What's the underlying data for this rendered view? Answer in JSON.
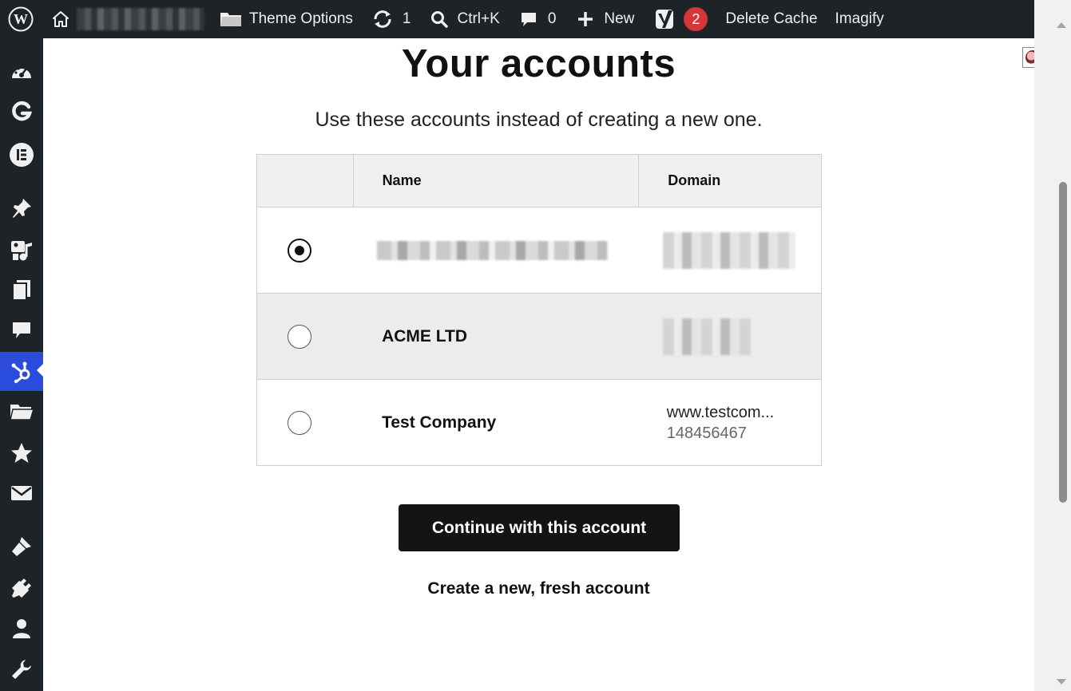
{
  "adminbar": {
    "theme_options": "Theme Options",
    "updates_count": "1",
    "search_shortcut": "Ctrl+K",
    "comments_count": "0",
    "new_label": "New",
    "yoast_badge": "2",
    "delete_cache": "Delete Cache",
    "imagify": "Imagify"
  },
  "sidebar": {
    "items": [
      "dashboard-icon",
      "g-icon",
      "elementor-icon",
      "pin-icon",
      "media-icon",
      "pages-icon",
      "comments-icon",
      "hubspot-icon",
      "folder-icon",
      "star-icon",
      "mail-icon",
      "brush-icon",
      "plugin-icon",
      "user-icon",
      "wrench-icon"
    ],
    "active": "hubspot-icon",
    "active_color": "#2b4bdc"
  },
  "main": {
    "title": "Your accounts",
    "subtitle": "Use these accounts instead of creating a new one.",
    "table": {
      "headers": [
        "",
        "Name",
        "Domain"
      ],
      "rows": [
        {
          "name": "",
          "domain": "",
          "domain_id": "",
          "selected": true,
          "redacted": true
        },
        {
          "name": "ACME LTD",
          "domain": "",
          "domain_id": "",
          "selected": false,
          "redacted_domain": true
        },
        {
          "name": "Test Company",
          "domain": "www.testcom...",
          "domain_id": "148456467",
          "selected": false
        }
      ]
    },
    "continue_button": "Continue with this account",
    "create_link": "Create a new, fresh account"
  }
}
